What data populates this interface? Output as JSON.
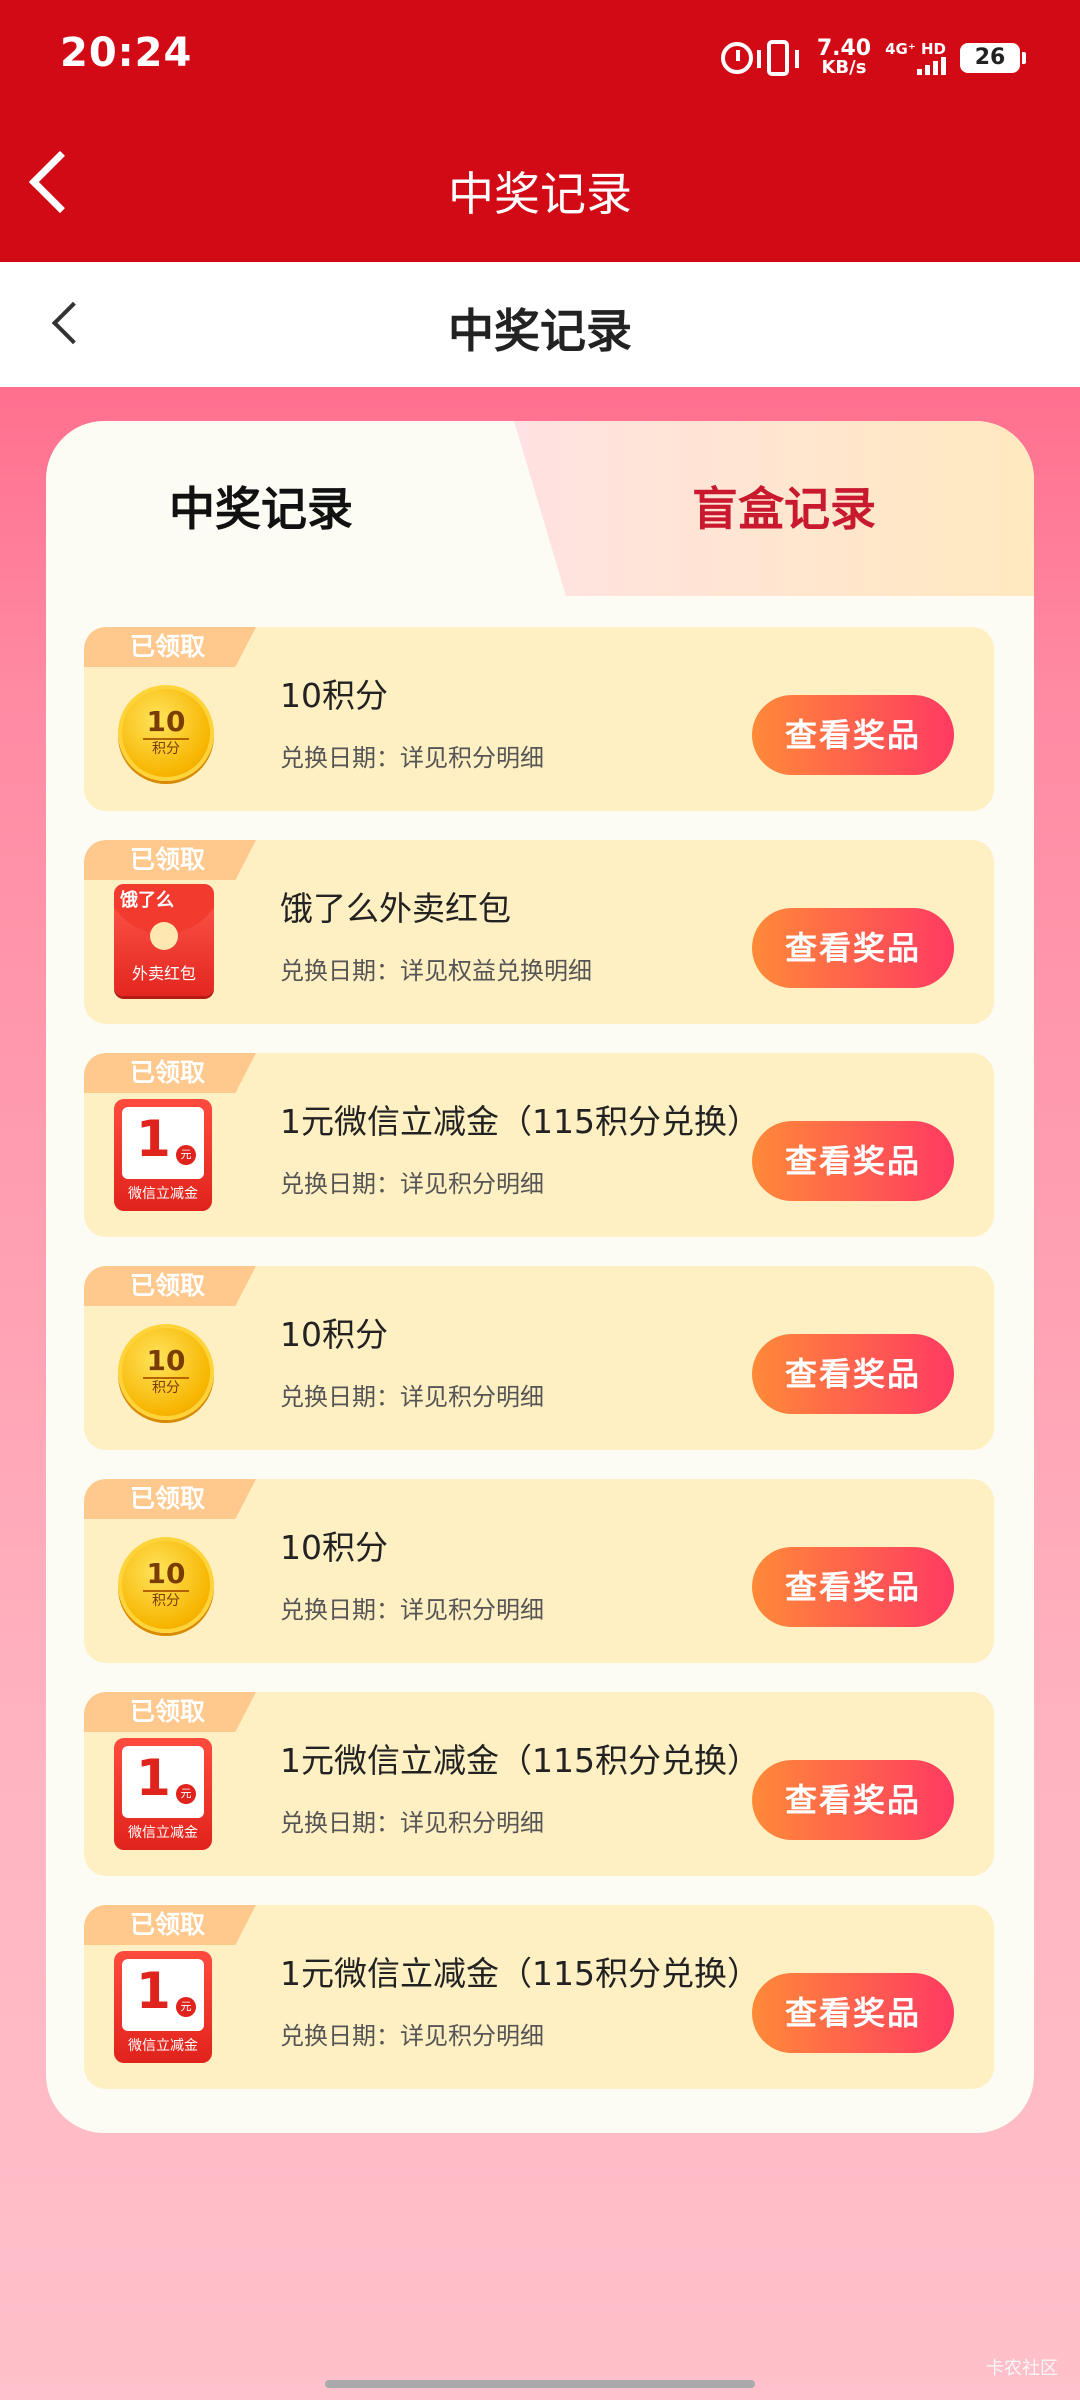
{
  "status_bar": {
    "time": "20:24",
    "net_speed_value": "7.40",
    "net_speed_unit": "KB/s",
    "network": "4G⁺ HD",
    "battery": "26"
  },
  "header": {
    "title": "中奖记录"
  },
  "subheader": {
    "title": "中奖记录"
  },
  "tabs": [
    {
      "label": "中奖记录",
      "active": true
    },
    {
      "label": "盲盒记录",
      "active": false
    }
  ],
  "records": [
    {
      "status": "已领取",
      "icon": "coin-icon",
      "icon_main": "10",
      "icon_sub": "积分",
      "title": "10积分",
      "detail": "兑换日期：详见积分明细",
      "button": "查看奖品"
    },
    {
      "status": "已领取",
      "icon": "red-envelope-icon",
      "icon_main": "饿了么",
      "icon_sub": "外卖红包",
      "title": "饿了么外卖红包",
      "detail": "兑换日期：详见权益兑换明细",
      "button": "查看奖品"
    },
    {
      "status": "已领取",
      "icon": "wechat-cash-icon",
      "icon_main": "1",
      "icon_unit": "元",
      "icon_sub": "微信立减金",
      "title": "1元微信立减金（115积分兑换）",
      "detail": "兑换日期：详见积分明细",
      "button": "查看奖品"
    },
    {
      "status": "已领取",
      "icon": "coin-icon",
      "icon_main": "10",
      "icon_sub": "积分",
      "title": "10积分",
      "detail": "兑换日期：详见积分明细",
      "button": "查看奖品"
    },
    {
      "status": "已领取",
      "icon": "coin-icon",
      "icon_main": "10",
      "icon_sub": "积分",
      "title": "10积分",
      "detail": "兑换日期：详见积分明细",
      "button": "查看奖品"
    },
    {
      "status": "已领取",
      "icon": "wechat-cash-icon",
      "icon_main": "1",
      "icon_unit": "元",
      "icon_sub": "微信立减金",
      "title": "1元微信立减金（115积分兑换）",
      "detail": "兑换日期：详见积分明细",
      "button": "查看奖品"
    },
    {
      "status": "已领取",
      "icon": "wechat-cash-icon",
      "icon_main": "1",
      "icon_unit": "元",
      "icon_sub": "微信立减金",
      "title": "1元微信立减金（115积分兑换）",
      "detail": "兑换日期：详见积分明细",
      "button": "查看奖品"
    }
  ],
  "watermark": "卡农社区",
  "colors": {
    "header_red": "#d20a16",
    "accent_red": "#c8192e",
    "button_from": "#ff8a38",
    "button_to": "#ff3a62",
    "row_bg": "#fff0c3"
  }
}
